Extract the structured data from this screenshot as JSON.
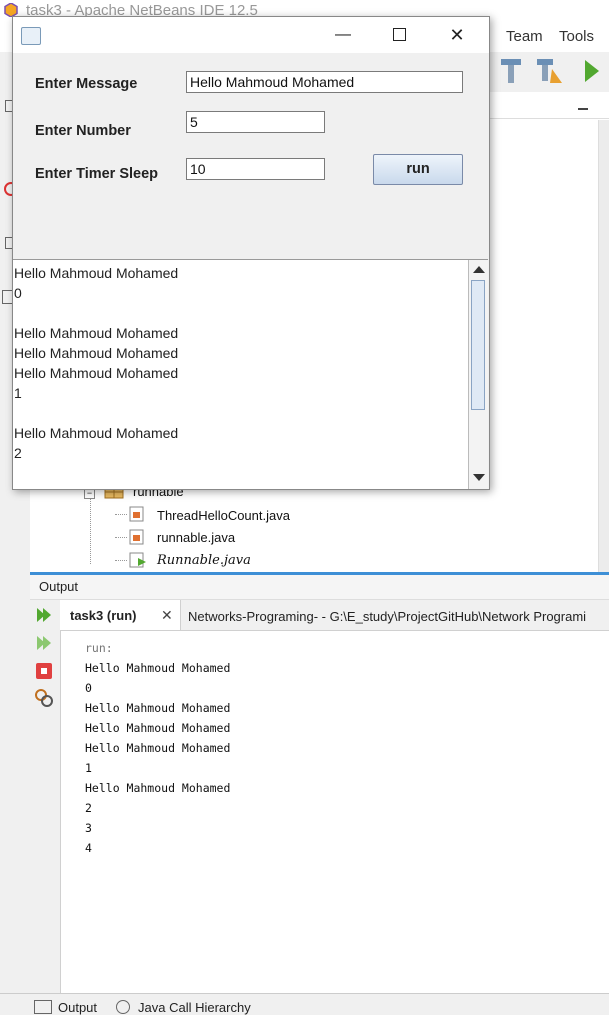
{
  "ide": {
    "title": "task3 - Apache NetBeans IDE 12.5",
    "menu": [
      "Team",
      "Tools"
    ],
    "tree": {
      "package": "runnable",
      "files": [
        "ThreadHelloCount.java",
        "runnable.java",
        "Runnable.java"
      ]
    },
    "output": {
      "panel_title": "Output",
      "tab_label": "task3 (run)",
      "tab_path": "Networks-Programing- - G:\\E_study\\ProjectGitHub\\Network Programi",
      "lines": [
        "run:",
        "Hello Mahmoud Mohamed",
        "0",
        "Hello Mahmoud Mohamed",
        "Hello Mahmoud Mohamed",
        "Hello Mahmoud Mohamed",
        "1",
        "Hello Mahmoud Mohamed",
        "2",
        "3",
        "4"
      ]
    },
    "bottom_tabs": [
      "Output",
      "Java Call Hierarchy"
    ]
  },
  "dialog": {
    "min_icon": "minimize-icon",
    "max_icon": "maximize-icon",
    "close_icon": "close-icon",
    "message_label": "Enter Message",
    "message_value": "Hello Mahmoud Mohamed",
    "number_label": "Enter Number",
    "number_value": "5",
    "sleep_label": "Enter Timer Sleep",
    "sleep_value": "10",
    "run_label": "run",
    "textarea_lines": [
      "Hello Mahmoud Mohamed",
      "0",
      "",
      "Hello Mahmoud Mohamed",
      "Hello Mahmoud Mohamed",
      "Hello Mahmoud Mohamed",
      "1",
      "",
      "Hello Mahmoud Mohamed",
      "2"
    ]
  },
  "colors": {
    "accent": "#3d8fd6",
    "run_icon": "#52a830",
    "stop_icon": "#e04040"
  }
}
